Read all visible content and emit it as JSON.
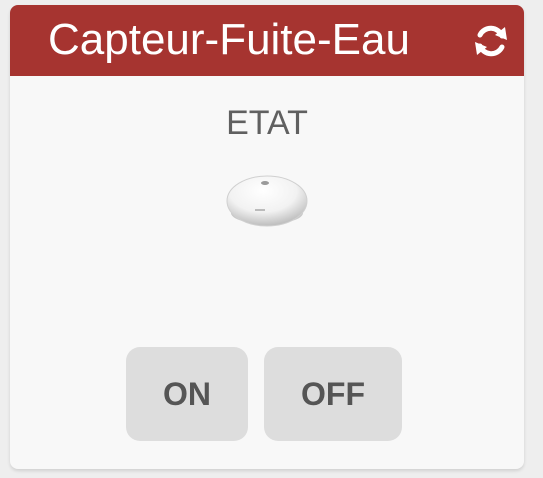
{
  "widget": {
    "title": "Capteur-Fuite-Eau",
    "refresh_icon": "refresh-icon",
    "state_label": "ETAT",
    "device_icon": "water-leak-sensor-icon",
    "buttons": {
      "on_label": "ON",
      "off_label": "OFF"
    }
  },
  "colors": {
    "header_background": "#a63430",
    "header_text": "#ffffff",
    "card_background": "#f8f8f8",
    "button_background": "#dddddd",
    "button_text": "#555555"
  }
}
